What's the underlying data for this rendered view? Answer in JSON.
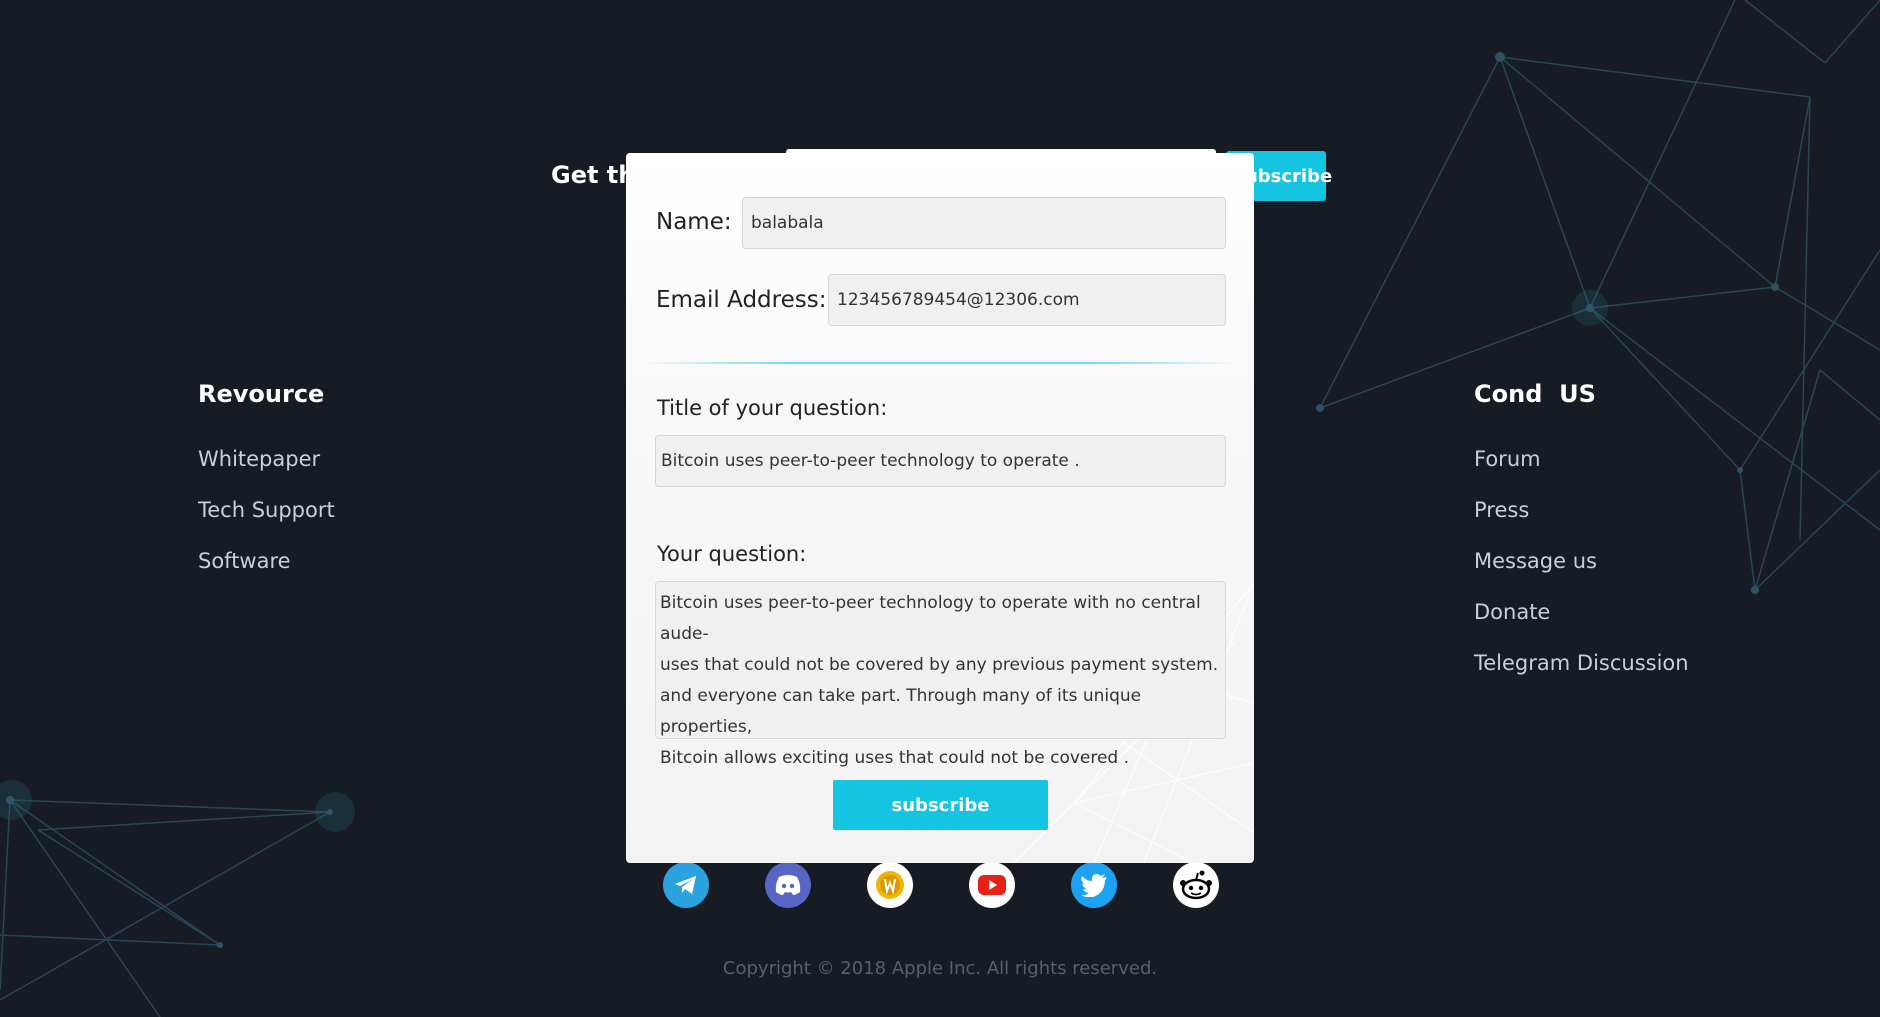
{
  "newsletter": {
    "title": "Get the",
    "button_label": "Subscribe"
  },
  "left_column": {
    "heading": "Revource",
    "links": [
      "Whitepaper",
      "Tech Support",
      "Software"
    ]
  },
  "right_column": {
    "heading": "Cond  US",
    "links": [
      "Forum",
      "Press",
      "Message us",
      "Donate",
      "Telegram Discussion"
    ]
  },
  "modal": {
    "name_label": "Name:",
    "name_value": "balabala",
    "email_label": "Email Address:",
    "email_value": "123456789454@12306.com",
    "title_label": "Title of your question:",
    "title_value": "Bitcoin uses peer-to-peer technology to operate .",
    "question_label": "Your question:",
    "question_lines": [
      "Bitcoin uses peer-to-peer technology to operate with no central aude-",
      "uses that could not be covered by any previous payment system.",
      "and everyone can take part. Through many of its unique properties,",
      "Bitcoin allows exciting uses that could not be covered ."
    ],
    "submit_label": "subscribe"
  },
  "social_icons": [
    "telegram-icon",
    "discord-icon",
    "coin-icon",
    "youtube-icon",
    "twitter-icon",
    "reddit-icon"
  ],
  "colors": {
    "background": "#161b24",
    "accent": "#14c4e0",
    "modal": "#f5f5f5"
  },
  "footer": {
    "copyright": "Copyright © 2018 Apple Inc. All rights reserved."
  }
}
